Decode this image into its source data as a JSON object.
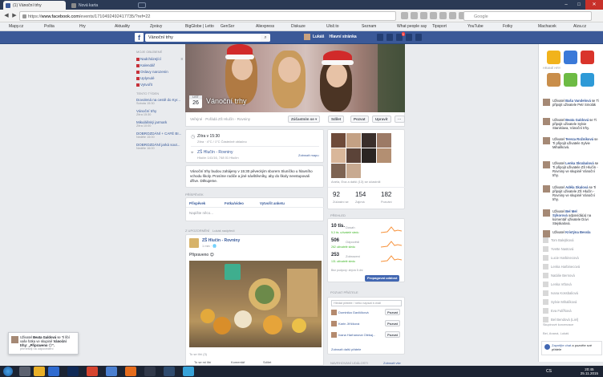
{
  "browser": {
    "tabs": [
      {
        "label": "(1) Vánoční trhy"
      },
      {
        "label": "Nová karta"
      }
    ],
    "url_host": "www.facebook.com",
    "url_rest": "/events/1710492492417735/?ref=22",
    "search_placeholder": "Google",
    "window_controls": {
      "minimize": "–",
      "maximize": "□",
      "close": "✕"
    },
    "bookmarks": [
      {
        "label": "Mapy.cz"
      },
      {
        "label": "Pošta"
      },
      {
        "label": "Hry"
      },
      {
        "label": "Aktuality"
      },
      {
        "label": "Zprávy"
      },
      {
        "label": "BigGlobe | Letto"
      },
      {
        "label": "GenSor"
      },
      {
        "label": "Aliexpress"
      },
      {
        "label": "Diskuze"
      },
      {
        "label": "Ulož.to"
      },
      {
        "label": "Seznam"
      },
      {
        "label": "What people say"
      },
      {
        "label": "Tipsport"
      },
      {
        "label": "YouTube"
      },
      {
        "label": "Fotky"
      },
      {
        "label": "Machacek"
      },
      {
        "label": "Alza.cz"
      }
    ]
  },
  "fb": {
    "search_value": "Vánoční trhy",
    "nav": {
      "profile": "Lukáš",
      "home": "Hlavní stránka"
    },
    "notif_count": "1",
    "left": {
      "section1": "Moje oblíbené",
      "items": [
        {
          "label": "Nadcházející",
          "count": "8"
        },
        {
          "label": "Kalendář"
        },
        {
          "label": "Oslavy narozenin"
        },
        {
          "label": "Uplynulé"
        },
        {
          "label": "Vytvořit"
        }
      ],
      "section2": "Tento týden",
      "events": [
        {
          "title": "Dovolená na cestě do Kyr...",
          "when": "Sobota 15:30"
        },
        {
          "title": "Vánoční trhy",
          "when": "Zítra 15:30"
        },
        {
          "title": "Mikulášský jarmark",
          "when": "Zítra 10:00"
        },
        {
          "title": "DOBROZDÁNÍ + CAFÉ BI...",
          "when": "Neděle 15:00"
        },
        {
          "title": "DOBROZDÁNÍ jarká sout...",
          "when": "Neděle 16:00"
        }
      ]
    },
    "event": {
      "month": "LIST",
      "day": "26",
      "title": "Vánoční trhy",
      "meta": "Veřejné · Pořádá ZŠ Hlučín - Rovniny",
      "buttons": {
        "going": "Zúčastním se ▾",
        "share": "Sdílet",
        "invite": "Pozvat",
        "edit": "Upravit",
        "more": "···"
      },
      "time_title": "Zítra v 15:30",
      "time_sub": "Zítra · 4°C / 1°C Částečně oblačno",
      "place_title": "ZŠ Hlučín - Rovniny",
      "place_sub": "Hlučín 141/16, 748 01 Hlučín",
      "show_map": "Zobrazit mapu",
      "description": "Vánoční trhy budou zahájeny v 15:30 pěveckým sborem Sluníčko u hlavního vchodu školy. Prosíme rodiče a jiné návštěvníky, aby do školy nevstupovali dříve. Děkujeme.",
      "write_label": "Příspěvek",
      "composer_tabs": {
        "post": "Příspěvek",
        "photo": "Fotka/video",
        "poll": "Vytvořit anketu"
      },
      "composer_placeholder": "Napište něco...",
      "feed_label": "Z upozornění",
      "feed_note": "Lukáš nadpředí",
      "post_author": "ZŠ Hlučín - Rovniny",
      "post_time": "1 min · 🌐",
      "post_text": "Připraveno 😊",
      "post_seen": "To se líbí (3)",
      "post_actions": {
        "like": "To se mi líbí",
        "comment": "Komentář",
        "share": "Sdílet"
      }
    },
    "right": {
      "friends_line": "Anela, Eva a další (13) se účastnili",
      "stats": [
        {
          "num": "92",
          "label": "Zúčastní se"
        },
        {
          "num": "154",
          "label": "Zajímá"
        },
        {
          "num": "182",
          "label": "Pozváni"
        }
      ],
      "insights_label": "Přehled",
      "insights": [
        {
          "num": "10 tis.",
          "label": "Dosah",
          "delta": "5,3 tis. uživatelé sledu"
        },
        {
          "num": "506",
          "label": "Odpovědi",
          "delta": "262 uživatelé sledu"
        },
        {
          "num": "253",
          "label": "Zobrazení",
          "delta": "131 uživatelé sledu"
        }
      ],
      "promote_note": "Bez podpory: zbývá 5 dní",
      "promote_button": "Propagovat událost",
      "invite_label": "Pozvat přátele",
      "invite_search_placeholder": "Hledat přátele / nebo napsat e-mail",
      "invite_btn": "Pozvat",
      "friends": [
        {
          "name": "Dominika Gavlíčková"
        },
        {
          "name": "Karin Jiříčková"
        },
        {
          "name": "Ivana Harhanová Olekaj..."
        }
      ],
      "show_all": "Zobrazit další přátele",
      "suggest_label": "Navrhovaní události",
      "suggest_link": "Zobrazit vše"
    },
    "ticker": [
      {
        "name": "Baša Vandelová",
        "text": "se Ti připojit uživatele Petr Smolák"
      },
      {
        "name": "Beata Galdová",
        "text": "se Ti připojit uživatele Sylvie Stanislava, Vánoční trhy."
      },
      {
        "name": "Tereza Rožníková",
        "text": "se Ti připojit uživatele Sylvie Mihalíková."
      },
      {
        "name": "Lenka Skrabalová",
        "text": "se Ti připojit uživatele ZŠ Hlučín - Rovniny ve skupině Vánoční trhy."
      },
      {
        "name": "Adéla Skalová",
        "text": "se Ti připojit uživatele ZŠ Hlučín - Rovniny ve skupině Vánoční trhy."
      },
      {
        "name": "Bel Mel Sýkorová",
        "text": "odpovídá(a) na komentář uživatele Dovi Stejskalová."
      },
      {
        "name": "Kristýna Bessla",
        "text": ""
      }
    ],
    "chat": [
      {
        "name": "Tom Balejtková"
      },
      {
        "name": "Yvette Nastová"
      },
      {
        "name": "Lucie Harbinecová"
      },
      {
        "name": "Lenka Harbinecová"
      },
      {
        "name": "Natálie Bernová"
      },
      {
        "name": "Lenka Vrbová"
      },
      {
        "name": "Ivana Kossbaliová"
      },
      {
        "name": "Sylvie Mihalíková"
      },
      {
        "name": "Eva Fulířková"
      },
      {
        "name": "Bel Bendová (Liel)"
      }
    ],
    "chat_section": "Skupinové konverzace",
    "chat_more": "Bei, Ananá, Lukáš",
    "chat_popup": {
      "name": "Zapnějte chat",
      "text": "a pozvěte své přátele"
    },
    "notif_popup": {
      "name": "Beata Galdová",
      "text": "se Ti líbí vaše fotka ve skupině",
      "group": "Vánoční trhy: „Připraveno 😊“.",
      "link": "příměšeji na odpovědění"
    }
  },
  "taskbar": {
    "lang": "CS",
    "time": "20:45",
    "date": "25.11.2015"
  },
  "colors": {
    "fb_blue": "#3b5998",
    "link": "#365899",
    "chrome_dark": "#2b3a55"
  }
}
